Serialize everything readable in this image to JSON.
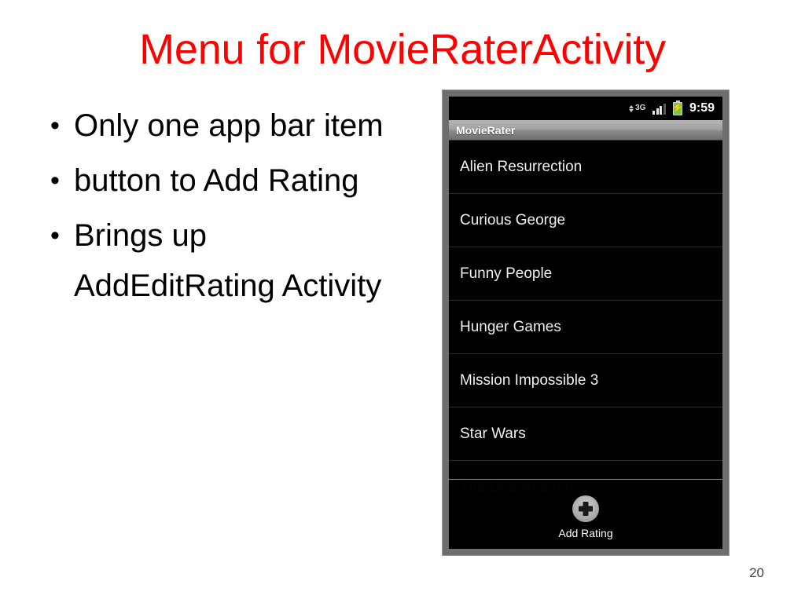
{
  "slide": {
    "title": "Menu for MovieRaterActivity",
    "title_color": "#ff0000",
    "page_number": "20",
    "bullets": [
      {
        "marker": "•",
        "text": "Only one app bar item"
      },
      {
        "marker": "•",
        "text": "button to Add Rating"
      },
      {
        "marker": "•",
        "text": "Brings up AddEditRating Activity"
      }
    ]
  },
  "phone": {
    "status_bar": {
      "network_label": "3G",
      "network_icon": "3g-data-icon",
      "signal_icon": "signal-bars-icon",
      "battery_icon": "battery-charging-icon",
      "battery_color": "#7dc832",
      "battery_bolt": "⚡",
      "time": "9:59"
    },
    "app_title_bar": {
      "title": "MovieRater"
    },
    "movie_list": [
      {
        "title": "Alien Resurrection",
        "dimmed": false
      },
      {
        "title": "Curious George",
        "dimmed": false
      },
      {
        "title": "Funny People",
        "dimmed": false
      },
      {
        "title": "Hunger Games",
        "dimmed": false
      },
      {
        "title": "Mission Impossible 3",
        "dimmed": false
      },
      {
        "title": "Star Wars",
        "dimmed": false
      },
      {
        "title": "The Descendants",
        "dimmed": true
      }
    ],
    "options_menu": {
      "items": [
        {
          "label": "Add Rating",
          "icon": "plus-circle-icon"
        }
      ]
    }
  }
}
